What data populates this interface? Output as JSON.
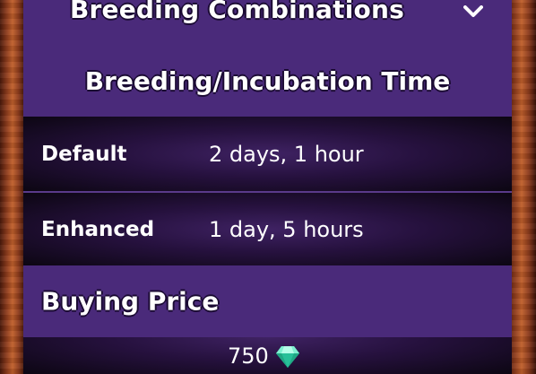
{
  "section_header": {
    "title": "Breeding Combinations"
  },
  "breeding_section": {
    "title": "Breeding/Incubation Time",
    "rows": [
      {
        "label": "Default",
        "value": "2 days, 1 hour"
      },
      {
        "label": "Enhanced",
        "value": "1 day, 5 hours"
      }
    ]
  },
  "buying_section": {
    "title": "Buying Price",
    "price": "750",
    "currency_icon": "gem-icon"
  },
  "colors": {
    "panel_purple": "#4a2a7a",
    "wood_frame": "#a0482a",
    "gem": "#2fd1a6"
  }
}
